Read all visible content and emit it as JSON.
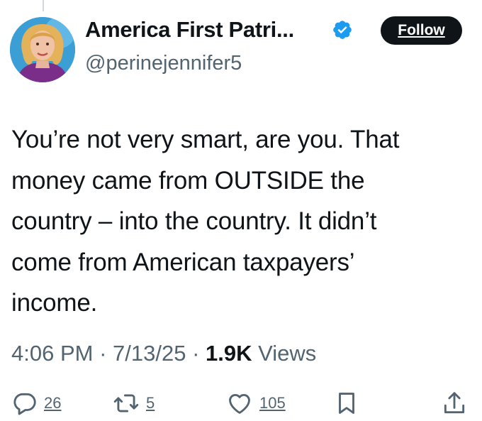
{
  "author": {
    "display_name": "America First Patri...",
    "handle": "@perinejennifer5",
    "verified": true
  },
  "follow_label": "Follow",
  "tweet": {
    "lines": [
      "You’re not very smart, are you. That",
      "money came from OUTSIDE the",
      "country – into the country. It didn’t",
      "come from American taxpayers’",
      "income."
    ]
  },
  "meta": {
    "time": "4:06 PM",
    "sep1": "·",
    "date": "7/13/25",
    "sep2": "·",
    "views_count": "1.9K",
    "views_label": "Views"
  },
  "actions": {
    "reply_count": "26",
    "retweet_count": "5",
    "like_count": "105"
  },
  "icons": {
    "reply": "reply-icon",
    "retweet": "retweet-icon",
    "like": "heart-icon",
    "bookmark": "bookmark-icon",
    "share": "share-icon",
    "verified": "verified-badge-icon"
  },
  "colors": {
    "text": "#0f1419",
    "secondary": "#536471",
    "verified": "#1d9bf0",
    "follow_bg": "#0f1419"
  }
}
